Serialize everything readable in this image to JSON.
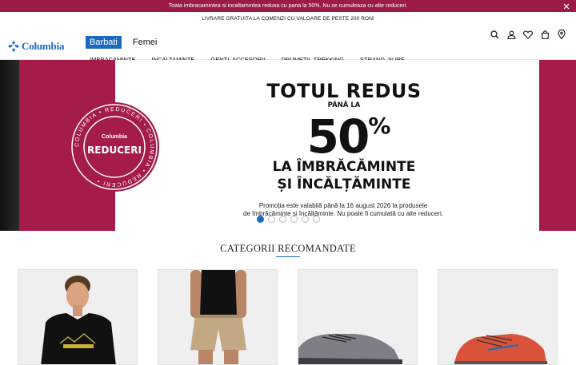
{
  "topbar": {
    "message": "Toata imbracamintea si incaltamintea redusa cu pana la 50%. Nu se cumuleaza cu alte reduceri.",
    "close_icon": "close-icon"
  },
  "header": {
    "shipping": "LIVRARE GRATUITA LA COMENZI CU VALOARE DE PESTE 200 RON!",
    "logo": "Columbia",
    "gender": [
      "Barbati",
      "Femei"
    ],
    "nav": [
      "IMBRACAMINTE",
      "INCALTAMINTE",
      "GENTI, ACCESORII",
      "DRUMETII, TREKKING",
      "STRAND, SURF"
    ],
    "icons": [
      "search-icon",
      "account-icon",
      "wishlist-icon",
      "cart-icon",
      "store-locator-icon"
    ]
  },
  "hero": {
    "badge_brand": "Columbia",
    "badge_text": "REDUCERI",
    "badge_ring": "COLUMBIA • REDUCERI • COLUMBIA • REDUCERI •",
    "headline": "TOTUL REDUS",
    "upto": "PÂNĂ LA",
    "percent": "50",
    "percent_sign": "%",
    "line1": "LA ÎMBRĂCĂMINTE",
    "line2": "ȘI ÎNCĂLȚĂMINTE",
    "terms_1": "Promoția este valabilă până la 16 august 2026 la produsele",
    "terms_2": "de îmbrăcăminte și încălțăminte. Nu poate fi cumulată cu alte reduceri.",
    "slides": 6,
    "active_slide": 1
  },
  "section": {
    "title": "CATEGORII RECOMANDATE"
  },
  "colors": {
    "brand_blue": "#1b6ac1",
    "promo_red": "#a51c4a"
  }
}
